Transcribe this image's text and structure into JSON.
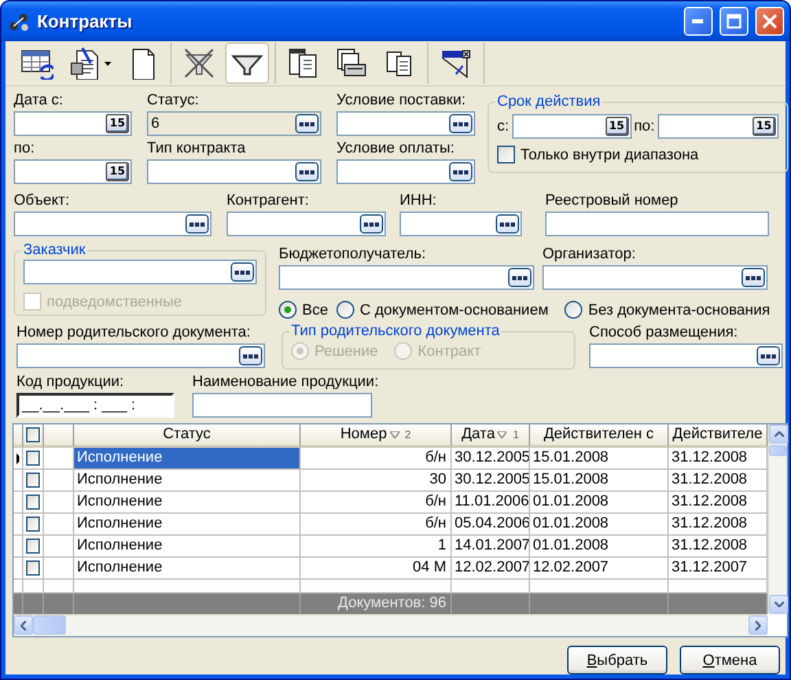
{
  "window": {
    "title": "Контракты"
  },
  "toolbar": [
    {
      "items": [
        {
          "kind": "refresh-table",
          "pressed": false,
          "dropdown": false
        },
        {
          "kind": "edit-document",
          "pressed": false,
          "dropdown": true
        },
        {
          "kind": "blank-page",
          "pressed": false,
          "dropdown": false
        }
      ]
    },
    {
      "items": [
        {
          "kind": "filter-off",
          "pressed": false,
          "dropdown": false
        },
        {
          "kind": "filter",
          "pressed": true,
          "dropdown": false
        }
      ]
    },
    {
      "items": [
        {
          "kind": "document-view",
          "pressed": false,
          "dropdown": false
        },
        {
          "kind": "print",
          "pressed": false,
          "dropdown": false
        },
        {
          "kind": "copies",
          "pressed": false,
          "dropdown": false
        }
      ]
    },
    {
      "items": [
        {
          "kind": "close-filter",
          "pressed": false,
          "dropdown": false
        }
      ]
    }
  ],
  "filters": {
    "date_from": {
      "label": "Дата с:",
      "kind": "date",
      "calendar": "15"
    },
    "date_to": {
      "label": "по:",
      "kind": "date",
      "calendar": "15"
    },
    "status": {
      "label": "Статус:",
      "value": "6",
      "kind": "lookup",
      "readonly": true
    },
    "contract_type": {
      "label": "Тип контракта",
      "kind": "lookup",
      "readonly": false
    },
    "delivery": {
      "label": "Условие поставки:",
      "kind": "lookup",
      "readonly": false
    },
    "payment": {
      "label": "Условие оплаты:",
      "kind": "lookup",
      "readonly": false
    },
    "validity": {
      "title": "Срок действия",
      "from": {
        "label": "с:",
        "kind": "date",
        "calendar": "15"
      },
      "to": {
        "label": "по:",
        "kind": "date",
        "calendar": "15"
      },
      "inside_only": {
        "label": "Только внутри диапазона",
        "checked": false,
        "disabled": false
      }
    },
    "object": {
      "label": "Объект:",
      "kind": "lookup",
      "readonly": false
    },
    "counterparty": {
      "label": "Контрагент:",
      "kind": "lookup",
      "readonly": false
    },
    "inn": {
      "label": "ИНН:",
      "kind": "lookup",
      "readonly": false
    },
    "registry_number": {
      "label": "Реестровый номер",
      "kind": "text",
      "readonly": false
    },
    "customer": {
      "title": "Заказчик",
      "field": {
        "kind": "lookup",
        "readonly": false
      },
      "subordinate": {
        "label": "подведомственные",
        "checked": false,
        "disabled": true
      }
    },
    "budget_recipient": {
      "label": "Бюджетополучатель:",
      "kind": "lookup",
      "readonly": false
    },
    "organizer": {
      "label": "Организатор:",
      "kind": "lookup",
      "readonly": false
    },
    "basis": [
      {
        "label": "Все",
        "selected": true
      },
      {
        "label": "С документом-основанием",
        "selected": false
      },
      {
        "label": "Без документа-основания",
        "selected": false
      }
    ],
    "parent_number": {
      "label": "Номер родительского документа:",
      "kind": "lookup",
      "readonly": false
    },
    "parent_type": {
      "title": "Тип родительского документа",
      "disabled": true,
      "options": [
        {
          "label": "Решение",
          "selected": true
        },
        {
          "label": "Контракт",
          "selected": false
        }
      ]
    },
    "placement": {
      "label": "Способ размещения:",
      "kind": "lookup",
      "readonly": false
    },
    "product_code": {
      "label": "Код продукции:",
      "value": "__.__.___ : ___ :",
      "kind": "mask",
      "readonly": false
    },
    "product_name": {
      "label": "Наименование продукции:",
      "kind": "text",
      "readonly": false
    }
  },
  "table": {
    "header_checked": false,
    "columns": [
      {
        "label": "Статус"
      },
      {
        "label": "Номер",
        "sort": "2"
      },
      {
        "label": "Дата",
        "sort": "1"
      },
      {
        "label": "Действителен с"
      },
      {
        "label": "Действителе"
      }
    ],
    "rows": [
      {
        "selected": true,
        "checked": false,
        "cells": [
          "Исполнение",
          "б/н",
          "30.12.2005",
          "15.01.2008",
          "31.12.2008"
        ]
      },
      {
        "selected": false,
        "checked": false,
        "cells": [
          "Исполнение",
          "30",
          "30.12.2005",
          "15.01.2008",
          "31.12.2008"
        ]
      },
      {
        "selected": false,
        "checked": false,
        "cells": [
          "Исполнение",
          "б/н",
          "11.01.2006",
          "01.01.2008",
          "31.12.2008"
        ]
      },
      {
        "selected": false,
        "checked": false,
        "cells": [
          "Исполнение",
          "б/н",
          "05.04.2006",
          "01.01.2008",
          "31.12.2008"
        ]
      },
      {
        "selected": false,
        "checked": false,
        "cells": [
          "Исполнение",
          "1",
          "14.01.2007",
          "01.01.2008",
          "31.12.2008"
        ]
      },
      {
        "selected": false,
        "checked": false,
        "cells": [
          "Исполнение",
          "04 М",
          "12.02.2007",
          "12.02.2007",
          "31.12.2007"
        ]
      }
    ],
    "footer": "Документов: 96"
  },
  "buttons": [
    {
      "label": "Выбрать"
    },
    {
      "label": "Отмена"
    }
  ]
}
